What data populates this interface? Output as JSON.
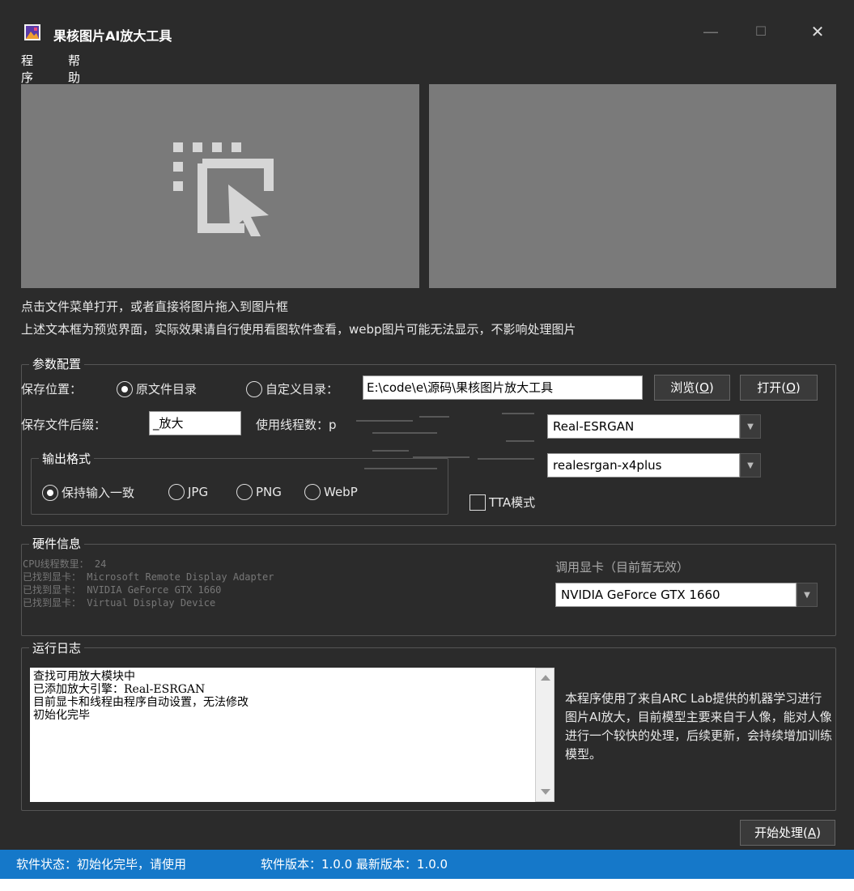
{
  "window": {
    "title": "果核图片AI放大工具",
    "minimize": "—",
    "maximize": "☐",
    "close": "✕"
  },
  "menu": {
    "items": [
      "程序",
      "帮助"
    ]
  },
  "hints": {
    "line1": "点击文件菜单打开，或者直接将图片拖入到图片框",
    "line2": "上述文本框为预览界面，实际效果请自行使用看图软件查看，webp图片可能无法显示，不影响处理图片"
  },
  "params": {
    "legend": "参数配置",
    "save_location_label": "保存位置：",
    "radio_original": "原文件目录",
    "radio_custom": "自定义目录：",
    "custom_path": "E:\\code\\e\\源码\\果核图片放大工具",
    "browse_prefix": "浏览(",
    "browse_key": "O",
    "open_prefix": "打开(",
    "open_key": "O",
    "suffix_label": "保存文件后缀：",
    "suffix_value": "_放大",
    "threads_label": "使用线程数：p",
    "engine_value": "Real-ESRGAN",
    "model_value": "realesrgan-x4plus",
    "tta_label": "TTA模式",
    "output_legend": "输出格式",
    "formats": [
      "保持输入一致",
      "JPG",
      "PNG",
      "WebP"
    ]
  },
  "hardware": {
    "legend": "硬件信息",
    "lines": [
      "CPU线程数里： 24",
      "已找到显卡： Microsoft Remote Display Adapter",
      "已找到显卡： NVIDIA GeForce GTX 1660",
      "已找到显卡： Virtual Display Device"
    ],
    "gpu_label": "调用显卡（目前暂无效）",
    "gpu_value": "NVIDIA GeForce GTX 1660"
  },
  "log": {
    "legend": "运行日志",
    "lines": [
      "查找可用放大模块中",
      "已添加放大引擎：Real-ESRGAN",
      "目前显卡和线程由程序自动设置，无法修改",
      "初始化完毕"
    ],
    "about": "本程序使用了来自ARC Lab提供的机器学习进行图片AI放大，目前模型主要来自于人像，能对人像进行一个较快的处理，后续更新，会持续增加训练模型。"
  },
  "start_prefix": "开始处理(",
  "start_key": "A",
  "status": {
    "state": "软件状态：初始化完毕，请使用",
    "version": "软件版本：1.0.0 最新版本：1.0.0"
  },
  "colors": {
    "accent": "#1578c9",
    "background": "#2b2b2b",
    "preview": "#7a7a7a"
  }
}
